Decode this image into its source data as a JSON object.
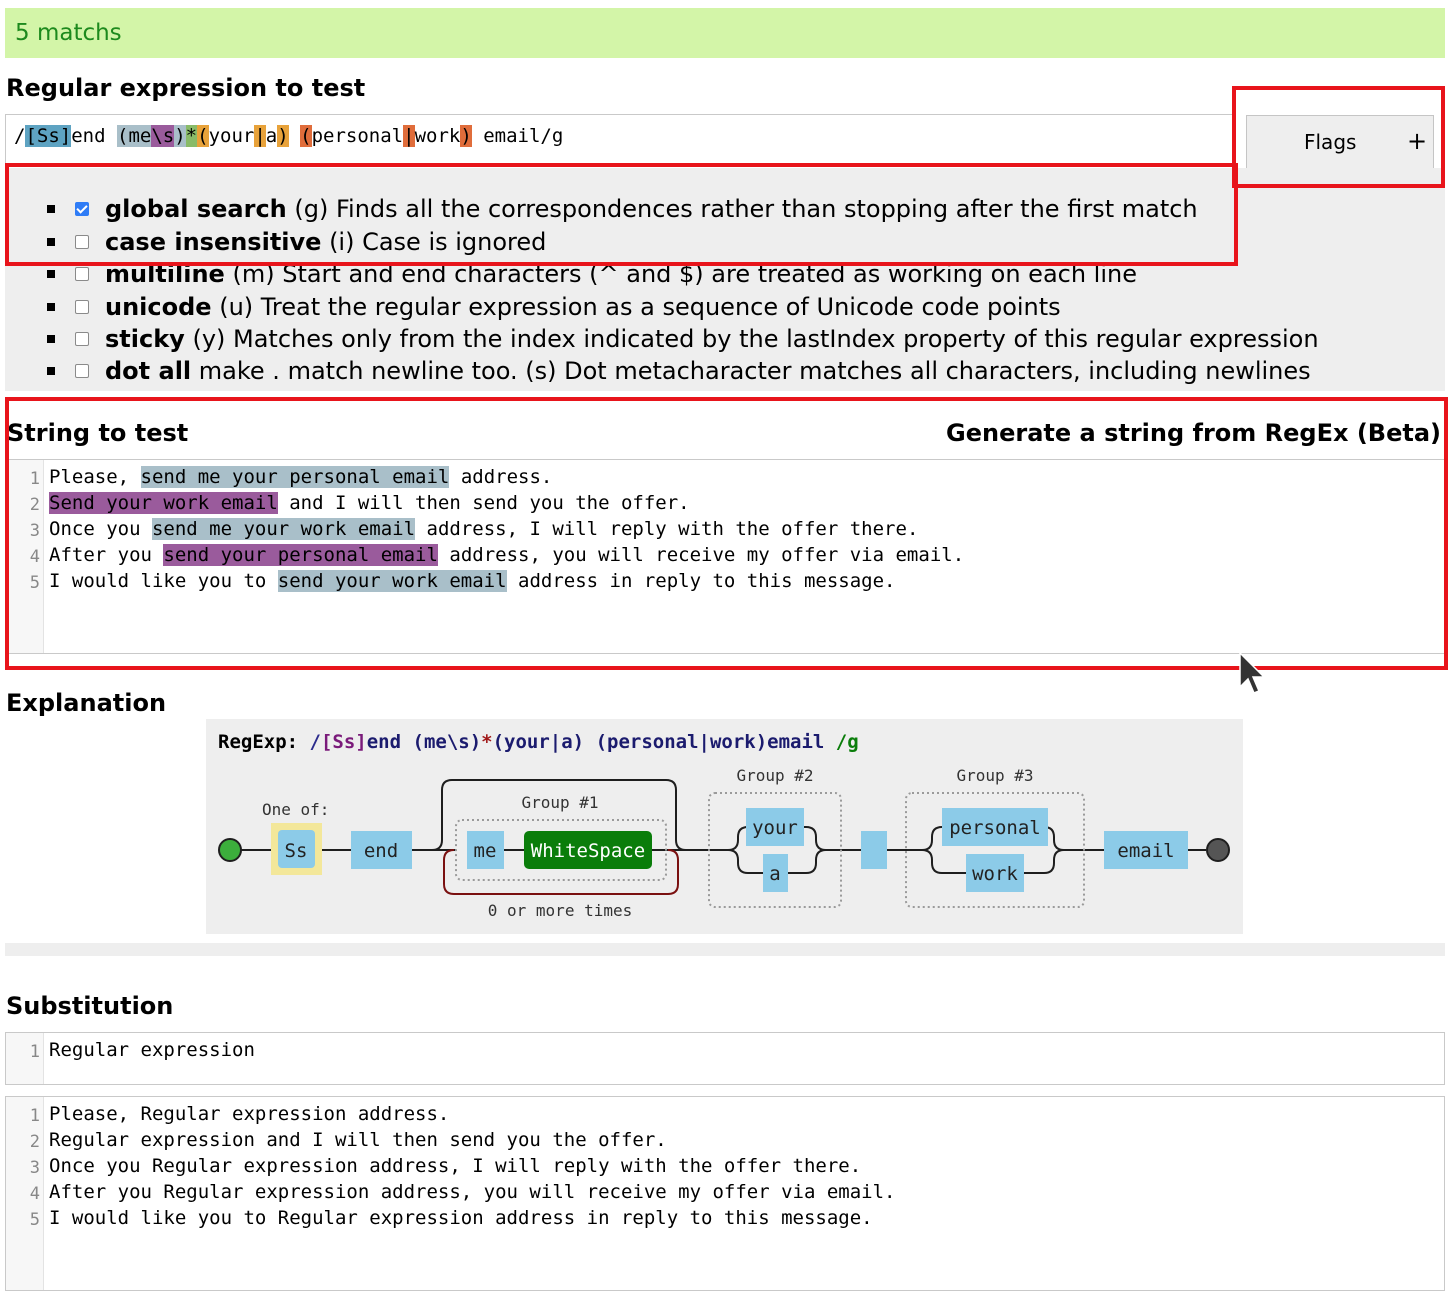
{
  "banner": {
    "matches": "5 matchs"
  },
  "regex": {
    "heading": "Regular expression to test",
    "tokens": {
      "open_slash": "/",
      "set": "[Ss]",
      "end": "end ",
      "g1_open": "(",
      "me": "me",
      "ws": "\\s",
      "g1_close": ")",
      "star": "*",
      "g2_open": "(",
      "your": "your",
      "alt": "|",
      "a": "a",
      "g2_close": ")",
      "sp": " ",
      "g3_open": "(",
      "personal": "personal",
      "alt3": "|",
      "work": "work",
      "g3_close": ")",
      "tail": " email/g"
    }
  },
  "flags_button": {
    "label": "Flags",
    "icon": "+"
  },
  "flags": [
    {
      "name": "global search",
      "desc": " (g) Finds all the correspondences rather than stopping after the first match",
      "checked": true
    },
    {
      "name": "case insensitive",
      "desc": " (i) Case is ignored",
      "checked": false
    },
    {
      "name": "multiline",
      "desc": " (m) Start and end characters (^ and $) are treated as working on each line",
      "checked": false
    },
    {
      "name": "unicode",
      "desc": " (u) Treat the regular expression as a sequence of Unicode code points",
      "checked": false
    },
    {
      "name": "sticky",
      "desc": " (y) Matches only from the index indicated by the lastIndex property of this regular expression",
      "checked": false
    },
    {
      "name": "dot all",
      "desc": " make . match newline too. (s) Dot metacharacter matches all characters, including newlines",
      "checked": false
    }
  ],
  "string_test": {
    "heading": "String to test",
    "generate_link": "Generate a string from RegEx (Beta)",
    "lines": [
      {
        "num": "1",
        "pre": "Please, ",
        "match": "send me your personal email",
        "post": " address."
      },
      {
        "num": "2",
        "pre": "",
        "match": "Send your work email",
        "post": " and I will then send you the offer."
      },
      {
        "num": "3",
        "pre": "Once you ",
        "match": "send me your work email",
        "post": " address, I will reply with the offer there."
      },
      {
        "num": "4",
        "pre": "After you ",
        "match": "send your personal email",
        "post": " address, you will receive my offer via email."
      },
      {
        "num": "5",
        "pre": "I would like you to ",
        "match": "send your work email",
        "post": " address in reply to this message."
      }
    ]
  },
  "explanation": {
    "heading": "Explanation",
    "regexp_prefix": "RegExp: ",
    "regexp_parts": {
      "slash": "/",
      "set": "[Ss]",
      "end": "end ",
      "g1": "(me\\s)",
      "star": "*",
      "g2": "(your|a)",
      "sp": " ",
      "g3": "(personal|work)",
      "email": "email ",
      "flags": "/g"
    },
    "nodes": {
      "one_of": "One of:",
      "ss": "Ss",
      "end": "end",
      "group1": "Group #1",
      "me": "me",
      "whitespace": "WhiteSpace",
      "repeat": "0 or more times",
      "group2": "Group #2",
      "your": "your",
      "a": "a",
      "group3": "Group #3",
      "personal": "personal",
      "work": "work",
      "email": "email"
    }
  },
  "substitution": {
    "heading": "Substitution",
    "input_line": {
      "num": "1",
      "text": "Regular expression"
    },
    "result_lines": [
      {
        "num": "1",
        "text": "Please, Regular expression address."
      },
      {
        "num": "2",
        "text": "Regular expression and I will then send you the offer."
      },
      {
        "num": "3",
        "text": "Once you Regular expression address, I will reply with the offer there."
      },
      {
        "num": "4",
        "text": "After you Regular expression address, you will receive my offer via email."
      },
      {
        "num": "5",
        "text": "I would like you to Regular expression address in reply to this message."
      }
    ]
  },
  "colors": {
    "banner_bg": "#d3f5a8",
    "banner_text": "#1d8a1d",
    "match_a": "#a9bfc9",
    "match_b": "#9a5b9c",
    "highlight_red": "#e8141b",
    "literal_blue": "#8ccbe8",
    "whitespace_green": "#0a7d0a"
  }
}
